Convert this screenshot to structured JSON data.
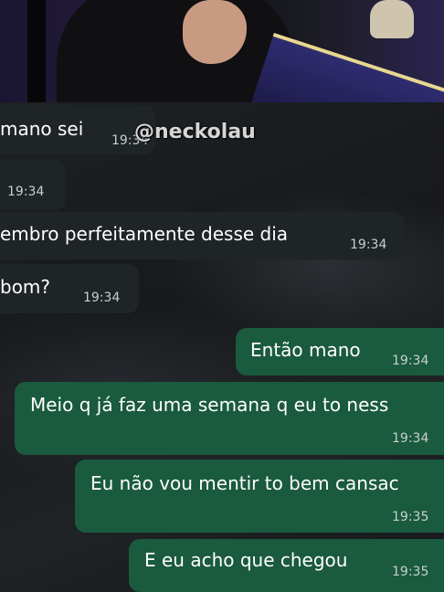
{
  "watermark": "@neckolau",
  "messages": [
    {
      "direction": "incoming",
      "text": "mano sei",
      "time": "19:34"
    },
    {
      "direction": "incoming",
      "text": "",
      "time": "19:34"
    },
    {
      "direction": "incoming",
      "text": "embro perfeitamente desse dia",
      "time": "19:34"
    },
    {
      "direction": "incoming",
      "text": "bom?",
      "time": "19:34"
    },
    {
      "direction": "outgoing",
      "text": "Então mano",
      "time": "19:34"
    },
    {
      "direction": "outgoing",
      "text": "Meio q já faz uma semana q eu to ness",
      "time": "19:34"
    },
    {
      "direction": "outgoing",
      "text": "Eu não vou mentir to bem cansac",
      "time": "19:35"
    },
    {
      "direction": "outgoing",
      "text": "E eu acho que chegou",
      "time": "19:35"
    }
  ],
  "colors": {
    "incoming_bubble": "#1f2427",
    "outgoing_bubble": "#1a5a3e",
    "background": "#15181b"
  }
}
